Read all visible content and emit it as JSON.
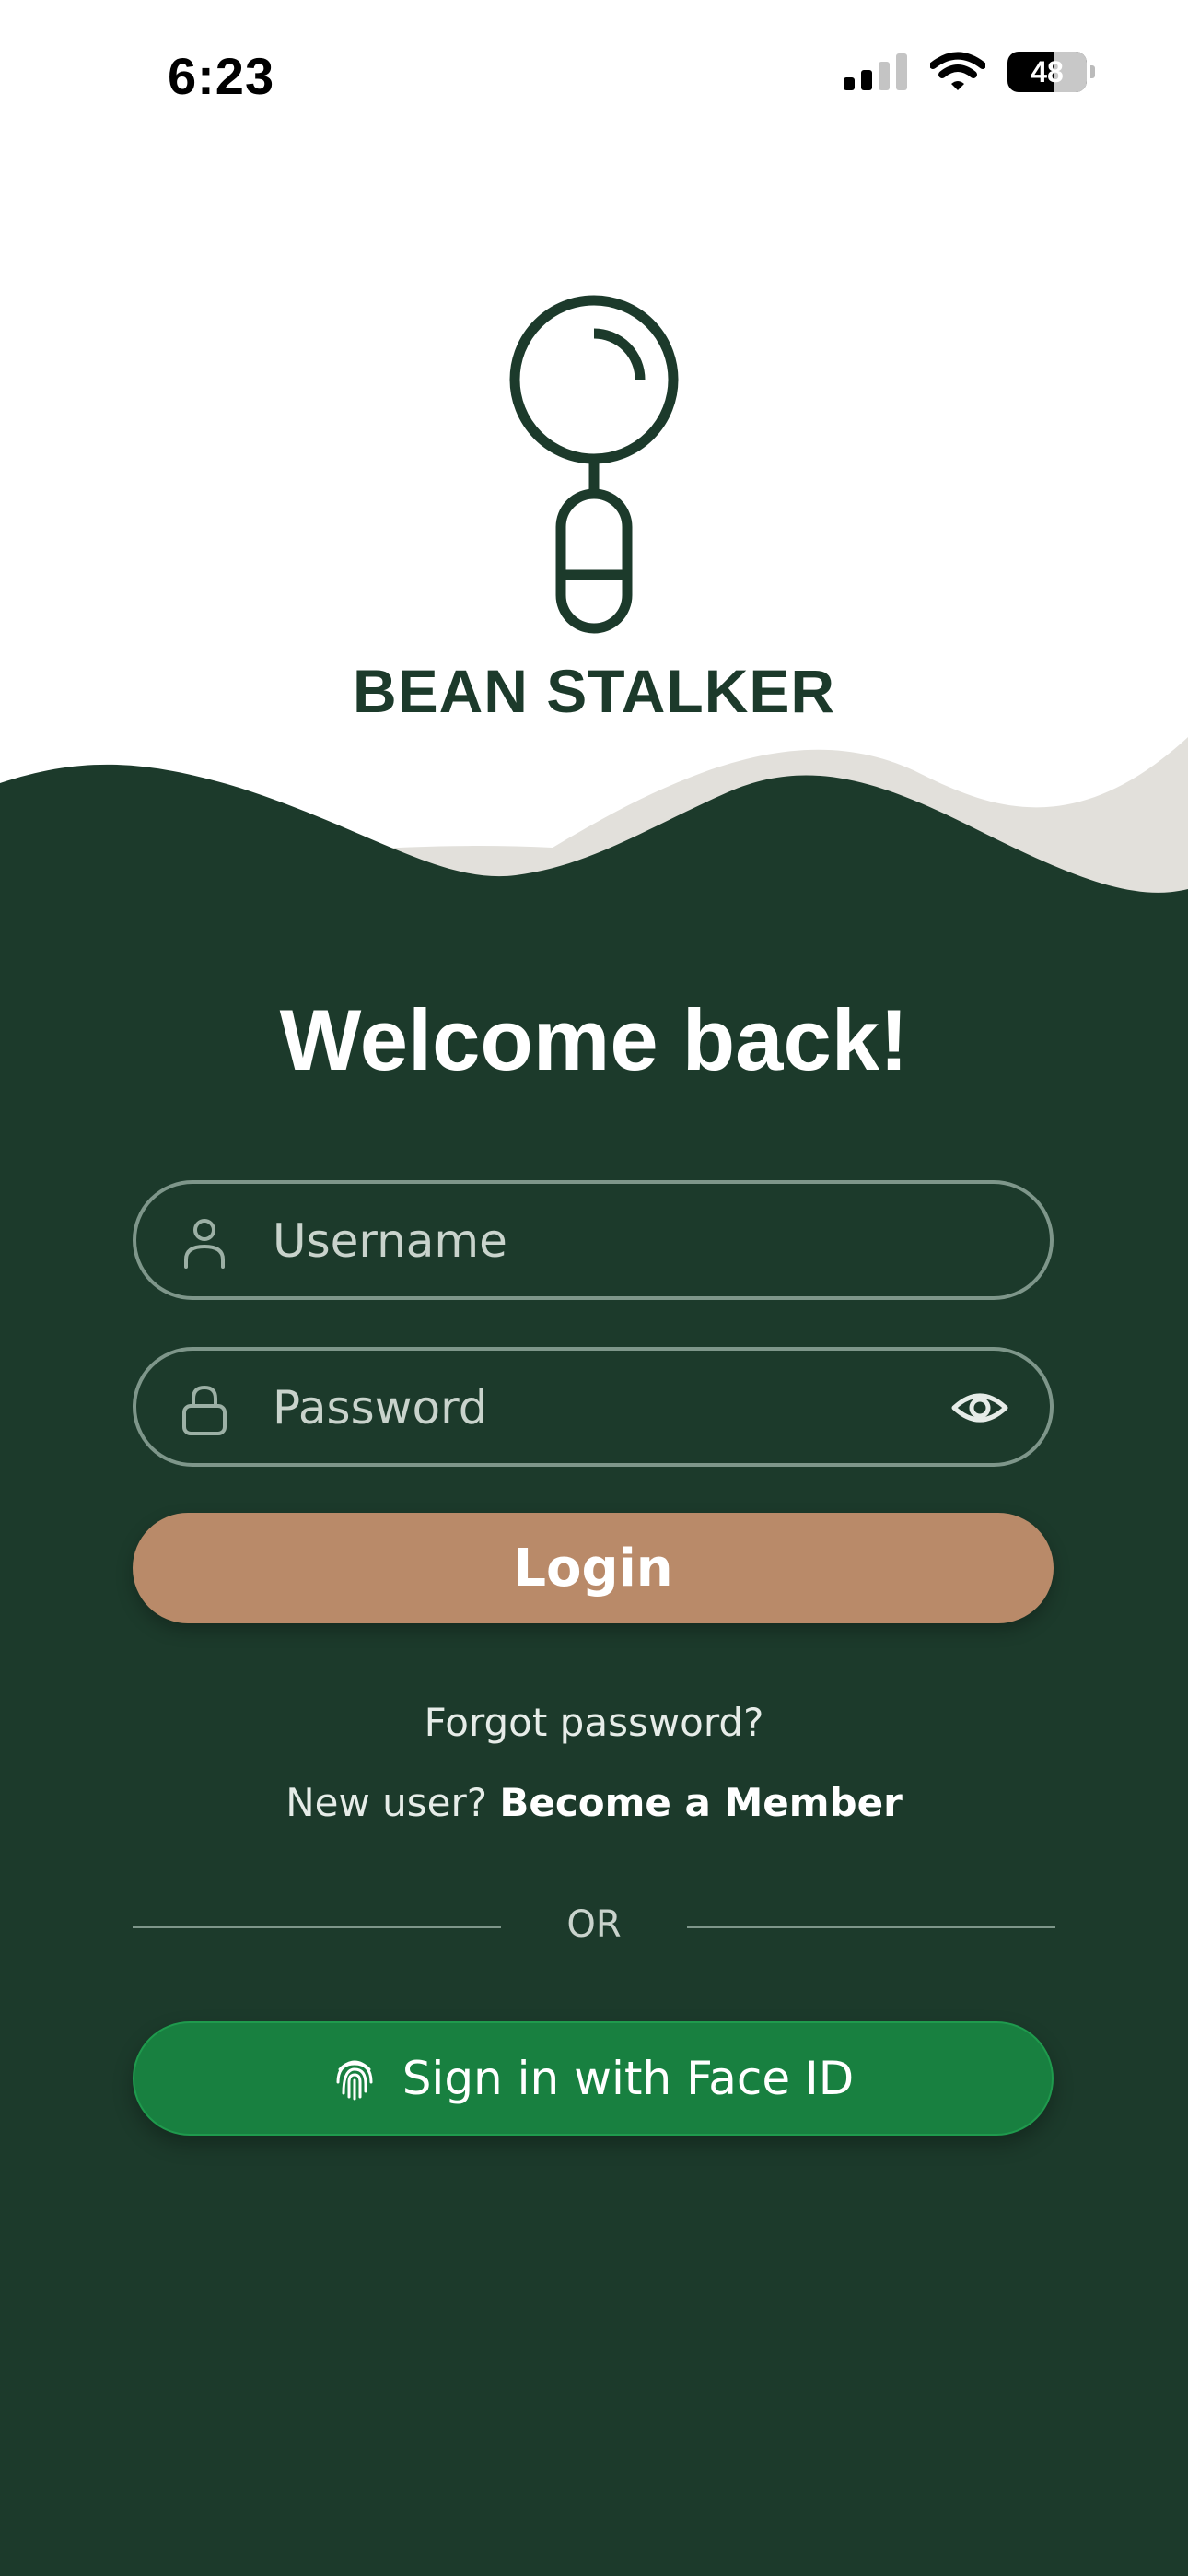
{
  "status_bar": {
    "time": "6:23",
    "battery_level": "48",
    "icons": [
      "cellular-signal-icon",
      "wifi-icon",
      "battery-icon"
    ]
  },
  "brand": {
    "name": "BEAN STALKER",
    "logo_icon": "magnifier-logo-icon"
  },
  "login": {
    "title": "Welcome back!",
    "username_placeholder": "Username",
    "password_placeholder": "Password",
    "login_button": "Login",
    "forgot_password": "Forgot password?",
    "new_user_prefix": "New user? ",
    "become_member": "Become a Member",
    "divider_text": "OR",
    "faceid_button": "Sign in with Face ID"
  },
  "colors": {
    "panel_green": "#1c3a2b",
    "login_button": "#b98a69",
    "faceid_button": "#188040",
    "wave_beige": "#e2e0db"
  }
}
